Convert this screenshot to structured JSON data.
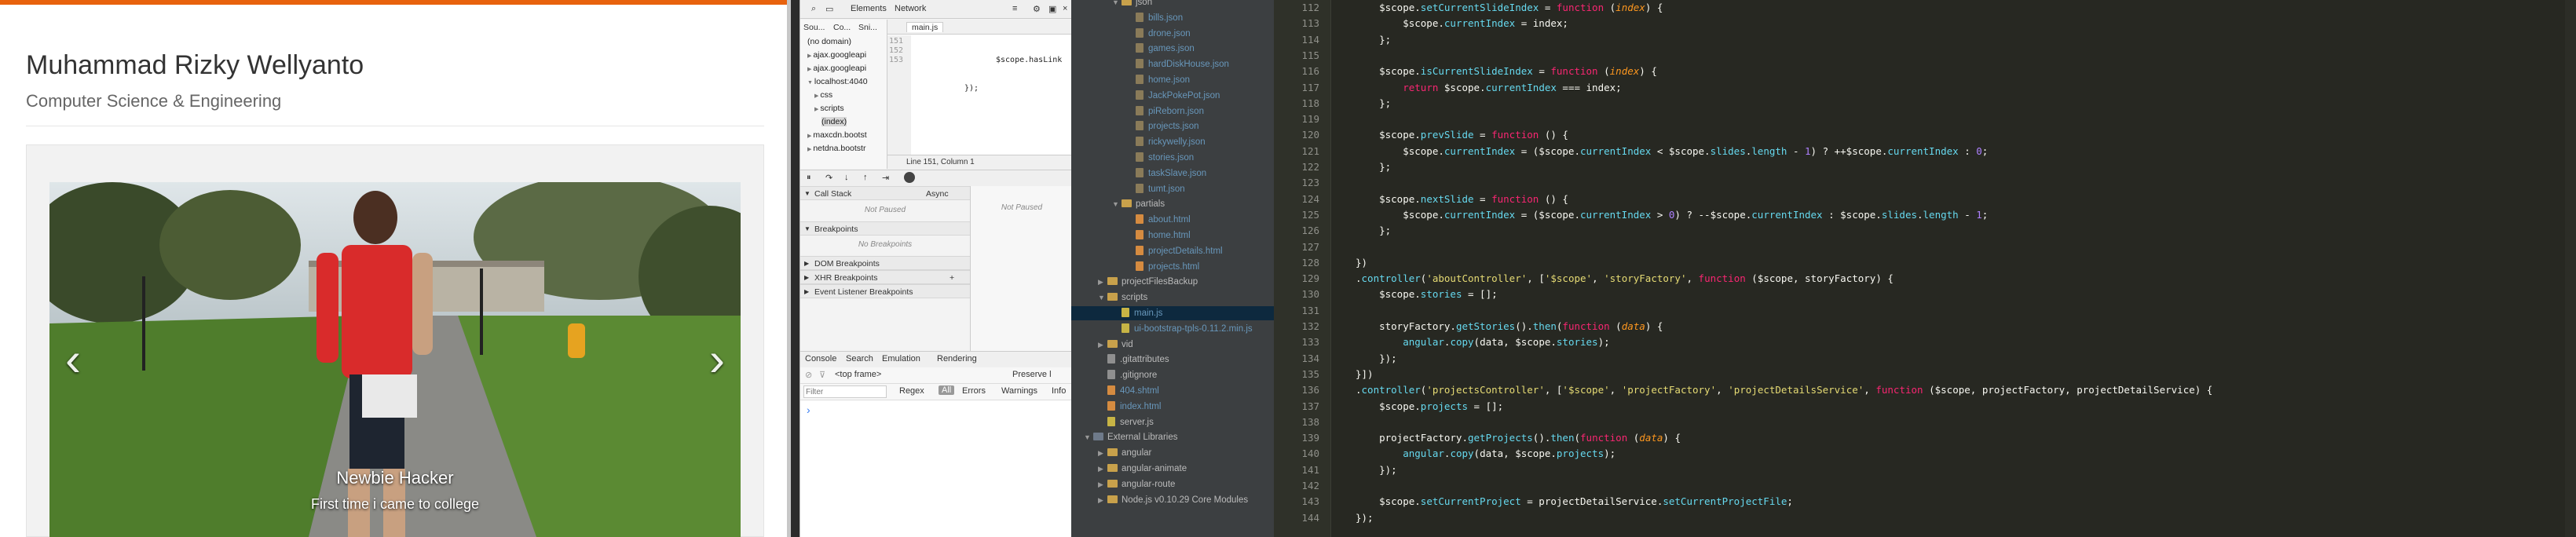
{
  "site": {
    "name": "Muhammad Rizky Wellyanto",
    "department": "Computer Science & Engineering",
    "carousel": {
      "caption_title": "Newbie Hacker",
      "caption_text": "First time i came to college",
      "prev": "‹",
      "next": "›"
    }
  },
  "devtools": {
    "toolbar_tabs": [
      "Elements",
      "Network"
    ],
    "sources_tabs": [
      "Sou...",
      "Co...",
      "Sni..."
    ],
    "open_file": "main.js",
    "tree": [
      "(no domain)",
      "ajax.googleapi",
      "ajax.googleapi",
      "localhost:4040",
      "css",
      "scripts",
      "(index)",
      "maxcdn.bootst",
      "netdna.bootstr"
    ],
    "code_line_numbers": [
      "151",
      "152",
      "153"
    ],
    "code_lines": [
      "$scope.hasLink",
      "});",
      ""
    ],
    "status": "Line 151, Column 1",
    "sections": {
      "call_stack": "Call Stack",
      "async": "Async",
      "not_paused": "Not Paused",
      "breakpoints": "Breakpoints",
      "no_breakpoints": "No Breakpoints",
      "dom_breakpoints": "DOM Breakpoints",
      "xhr_breakpoints": "XHR Breakpoints",
      "event_listener_breakpoints": "Event Listener Breakpoints"
    },
    "scope_not_paused": "Not Paused",
    "drawer_tabs": [
      "Console",
      "Search",
      "Emulation",
      "Rendering"
    ],
    "frame_select": "<top frame>",
    "preserve_log": "Preserve l",
    "filter_placeholder": "Filter",
    "regex": "Regex",
    "levels": [
      "All",
      "Errors",
      "Warnings",
      "Info"
    ],
    "prompt": "›"
  },
  "project_tree": {
    "items": [
      {
        "label": "json",
        "type": "folder",
        "indent": 1,
        "open": true
      },
      {
        "label": "bills.json",
        "type": "json",
        "indent": 2
      },
      {
        "label": "drone.json",
        "type": "json",
        "indent": 2
      },
      {
        "label": "games.json",
        "type": "json",
        "indent": 2
      },
      {
        "label": "hardDiskHouse.json",
        "type": "json",
        "indent": 2
      },
      {
        "label": "home.json",
        "type": "json",
        "indent": 2
      },
      {
        "label": "JackPokePot.json",
        "type": "json",
        "indent": 2
      },
      {
        "label": "piReborn.json",
        "type": "json",
        "indent": 2
      },
      {
        "label": "projects.json",
        "type": "json",
        "indent": 2
      },
      {
        "label": "rickywelly.json",
        "type": "json",
        "indent": 2
      },
      {
        "label": "stories.json",
        "type": "json",
        "indent": 2
      },
      {
        "label": "taskSlave.json",
        "type": "json",
        "indent": 2
      },
      {
        "label": "tumt.json",
        "type": "json",
        "indent": 2
      },
      {
        "label": "partials",
        "type": "folder",
        "indent": 1,
        "open": true
      },
      {
        "label": "about.html",
        "type": "html",
        "indent": 2
      },
      {
        "label": "home.html",
        "type": "html",
        "indent": 2
      },
      {
        "label": "projectDetails.html",
        "type": "html",
        "indent": 2
      },
      {
        "label": "projects.html",
        "type": "html",
        "indent": 2
      },
      {
        "label": "projectFilesBackup",
        "type": "folder",
        "indent": 0,
        "open": false
      },
      {
        "label": "scripts",
        "type": "folder",
        "indent": 0,
        "open": true
      },
      {
        "label": "main.js",
        "type": "js",
        "indent": 1,
        "selected": true
      },
      {
        "label": "ui-bootstrap-tpls-0.11.2.min.js",
        "type": "js",
        "indent": 1
      },
      {
        "label": "vid",
        "type": "folder",
        "indent": 0,
        "open": false
      },
      {
        "label": ".gitattributes",
        "type": "misc",
        "indent": 0
      },
      {
        "label": ".gitignore",
        "type": "misc",
        "indent": 0
      },
      {
        "label": "404.shtml",
        "type": "html",
        "indent": 0
      },
      {
        "label": "index.html",
        "type": "html",
        "indent": 0
      },
      {
        "label": "server.js",
        "type": "js",
        "indent": 0
      },
      {
        "label": "External Libraries",
        "type": "lib",
        "indent": -1,
        "open": true
      },
      {
        "label": "angular",
        "type": "folder",
        "indent": 0,
        "open": false
      },
      {
        "label": "angular-animate",
        "type": "folder",
        "indent": 0,
        "open": false
      },
      {
        "label": "angular-route",
        "type": "folder",
        "indent": 0,
        "open": false
      },
      {
        "label": "Node.js v0.10.29 Core Modules",
        "type": "folder",
        "indent": 0,
        "open": false
      }
    ]
  },
  "editor": {
    "lines": [
      {
        "n": "112",
        "html": "    $scope.<span class=\"m\">setCurrentSlideIndex</span> = <span class=\"k\">function</span> (<span class=\"p\">index</span>) {"
      },
      {
        "n": "113",
        "html": "        $scope.<span class=\"m\">currentIndex</span> = index;"
      },
      {
        "n": "114",
        "html": "    };"
      },
      {
        "n": "115",
        "html": ""
      },
      {
        "n": "116",
        "html": "    $scope.<span class=\"m\">isCurrentSlideIndex</span> = <span class=\"k\">function</span> (<span class=\"p\">index</span>) {"
      },
      {
        "n": "117",
        "html": "        <span class=\"k\">return</span> $scope.<span class=\"m\">currentIndex</span> === index;"
      },
      {
        "n": "118",
        "html": "    };"
      },
      {
        "n": "119",
        "html": ""
      },
      {
        "n": "120",
        "html": "    $scope.<span class=\"m\">prevSlide</span> = <span class=\"k\">function</span> () {"
      },
      {
        "n": "121",
        "html": "        $scope.<span class=\"m\">currentIndex</span> = ($scope.<span class=\"m\">currentIndex</span> &lt; $scope.<span class=\"m\">slides</span>.<span class=\"m\">length</span> - <span class=\"num\">1</span>) ? ++$scope.<span class=\"m\">currentIndex</span> : <span class=\"num\">0</span>;"
      },
      {
        "n": "122",
        "html": "    };"
      },
      {
        "n": "123",
        "html": ""
      },
      {
        "n": "124",
        "html": "    $scope.<span class=\"m\">nextSlide</span> = <span class=\"k\">function</span> () {"
      },
      {
        "n": "125",
        "html": "        $scope.<span class=\"m\">currentIndex</span> = ($scope.<span class=\"m\">currentIndex</span> &gt; <span class=\"num\">0</span>) ? --$scope.<span class=\"m\">currentIndex</span> : $scope.<span class=\"m\">slides</span>.<span class=\"m\">length</span> - <span class=\"num\">1</span>;"
      },
      {
        "n": "126",
        "html": "    };"
      },
      {
        "n": "127",
        "html": ""
      },
      {
        "n": "128",
        "html": "})"
      },
      {
        "n": "129",
        "html": ".<span class=\"m\">controller</span>(<span class=\"s\">'aboutController'</span>, [<span class=\"s\">'$scope'</span>, <span class=\"s\">'storyFactory'</span>, <span class=\"k\">function</span> ($scope, storyFactory) {"
      },
      {
        "n": "130",
        "html": "    $scope.<span class=\"m\">stories</span> = [];"
      },
      {
        "n": "131",
        "html": ""
      },
      {
        "n": "132",
        "html": "    storyFactory.<span class=\"m\">getStories</span>().<span class=\"m\">then</span>(<span class=\"k\">function</span> (<span class=\"p\">data</span>) {"
      },
      {
        "n": "133",
        "html": "        <span class=\"m\">angular</span>.<span class=\"m\">copy</span>(data, $scope.<span class=\"m\">stories</span>);"
      },
      {
        "n": "134",
        "html": "    });"
      },
      {
        "n": "135",
        "html": "}])"
      },
      {
        "n": "136",
        "html": ".<span class=\"m\">controller</span>(<span class=\"s\">'projectsController'</span>, [<span class=\"s\">'$scope'</span>, <span class=\"s\">'projectFactory'</span>, <span class=\"s\">'projectDetailsService'</span>, <span class=\"k\">function</span> ($scope, projectFactory, projectDetailService) {"
      },
      {
        "n": "137",
        "html": "    $scope.<span class=\"m\">projects</span> = [];"
      },
      {
        "n": "138",
        "html": ""
      },
      {
        "n": "139",
        "html": "    projectFactory.<span class=\"m\">getProjects</span>().<span class=\"m\">then</span>(<span class=\"k\">function</span> (<span class=\"p\">data</span>) {"
      },
      {
        "n": "140",
        "html": "        <span class=\"m\">angular</span>.<span class=\"m\">copy</span>(data, $scope.<span class=\"m\">projects</span>);"
      },
      {
        "n": "141",
        "html": "    });"
      },
      {
        "n": "142",
        "html": ""
      },
      {
        "n": "143",
        "html": "    $scope.<span class=\"m\">setCurrentProject</span> = projectDetailService.<span class=\"m\">setCurrentProjectFile</span>;"
      },
      {
        "n": "144",
        "html": "});"
      }
    ]
  },
  "colors": {
    "site_accent": "#e8620d",
    "editor_bg": "#272822",
    "tree_bg": "#3c3f41",
    "json_file_text": "#6897bb"
  }
}
